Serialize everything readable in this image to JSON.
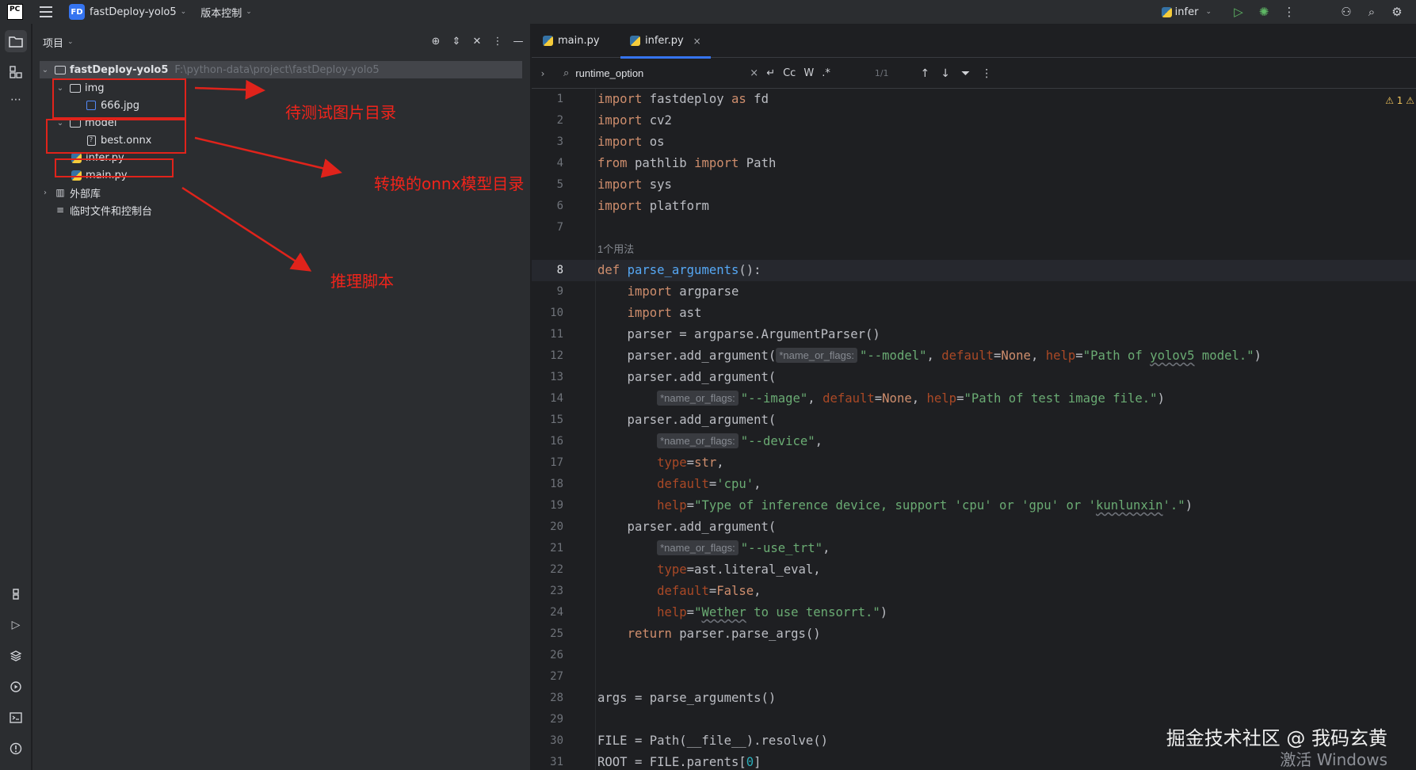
{
  "titlebar": {
    "app_logo": "PC",
    "project_badge": "FD",
    "project_name": "fastDeploy-yolo5",
    "vcs_label": "版本控制",
    "run_config": "infer"
  },
  "project_panel": {
    "title": "项目",
    "tree": [
      {
        "label": "fastDeploy-yolo5",
        "hint": "F:\\python-data\\project\\fastDeploy-yolo5"
      },
      {
        "label": "img"
      },
      {
        "label": "666.jpg"
      },
      {
        "label": "model"
      },
      {
        "label": "best.onnx"
      },
      {
        "label": "infer.py"
      },
      {
        "label": "main.py"
      },
      {
        "label": "外部库"
      },
      {
        "label": "临时文件和控制台"
      }
    ]
  },
  "annotations": {
    "img_dir": "待测试图片目录",
    "model_dir": "转换的onnx模型目录",
    "script": "推理脚本"
  },
  "editor": {
    "tabs": [
      {
        "label": "main.py"
      },
      {
        "label": "infer.py"
      }
    ],
    "find": {
      "query": "runtime_option",
      "opt_case": "Cc",
      "opt_word": "W",
      "opt_regex": ".*",
      "count": "1/1"
    },
    "warning_count": "1",
    "usage_hint": "1个用法",
    "param_hint": "*name_or_flags:",
    "line_numbers": [
      "1",
      "2",
      "3",
      "4",
      "5",
      "6",
      "7",
      "8",
      "9",
      "10",
      "11",
      "12",
      "13",
      "14",
      "15",
      "16",
      "17",
      "18",
      "19",
      "20",
      "21",
      "22",
      "23",
      "24",
      "25",
      "26",
      "27",
      "28",
      "29",
      "30",
      "31"
    ]
  },
  "watermark": {
    "text": "掘金技术社区 @ 我码玄黄",
    "activate": "激活 Windows"
  },
  "colors": {
    "accent": "#3574f0",
    "annotation_red": "#e0231b",
    "keyword": "#cf8e6d",
    "string": "#6aab73",
    "function": "#56a8f5"
  }
}
